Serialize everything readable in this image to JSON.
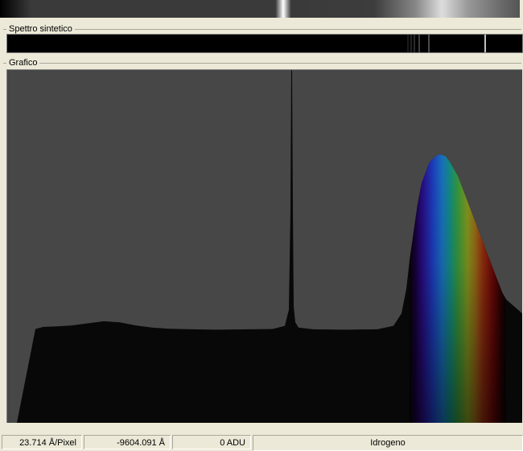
{
  "panels": {
    "synthetic_spectrum_label": "Spettro sintetico",
    "graph_label": "Grafico"
  },
  "status": {
    "dispersion": "23.714 Å/Pixel",
    "wavelength": "-9604.091 Å",
    "intensity": "0 ADU",
    "element": "Idrogeno"
  },
  "colors": {
    "background": "#ece9d8",
    "plot_background": "#474747",
    "profile_fill": "#080808"
  },
  "chart_data": {
    "type": "area",
    "title": "",
    "xlabel": "",
    "ylabel": "",
    "x_range": [
      0,
      640
    ],
    "y_range": [
      0,
      1
    ],
    "x": [
      0,
      12,
      35,
      45,
      60,
      80,
      100,
      120,
      140,
      160,
      180,
      200,
      230,
      260,
      300,
      330,
      345,
      350,
      352,
      353,
      354,
      355,
      356,
      358,
      362,
      380,
      420,
      460,
      480,
      490,
      496,
      500,
      505,
      510,
      515,
      520,
      525,
      530,
      535,
      540,
      545,
      550,
      555,
      560,
      565,
      570,
      575,
      580,
      585,
      590,
      595,
      600,
      605,
      610,
      615,
      620,
      625,
      630,
      635,
      640
    ],
    "y": [
      0,
      0,
      0.266,
      0.272,
      0.273,
      0.276,
      0.282,
      0.288,
      0.285,
      0.276,
      0.27,
      0.267,
      0.265,
      0.264,
      0.265,
      0.266,
      0.275,
      0.32,
      0.6,
      0.999,
      0.999,
      0.6,
      0.33,
      0.285,
      0.27,
      0.265,
      0.264,
      0.265,
      0.275,
      0.31,
      0.38,
      0.46,
      0.54,
      0.62,
      0.68,
      0.71,
      0.74,
      0.75,
      0.76,
      0.76,
      0.755,
      0.74,
      0.72,
      0.7,
      0.67,
      0.64,
      0.61,
      0.58,
      0.55,
      0.52,
      0.49,
      0.46,
      0.43,
      0.4,
      0.37,
      0.35,
      0.34,
      0.33,
      0.32,
      0.31
    ],
    "grid": false
  }
}
